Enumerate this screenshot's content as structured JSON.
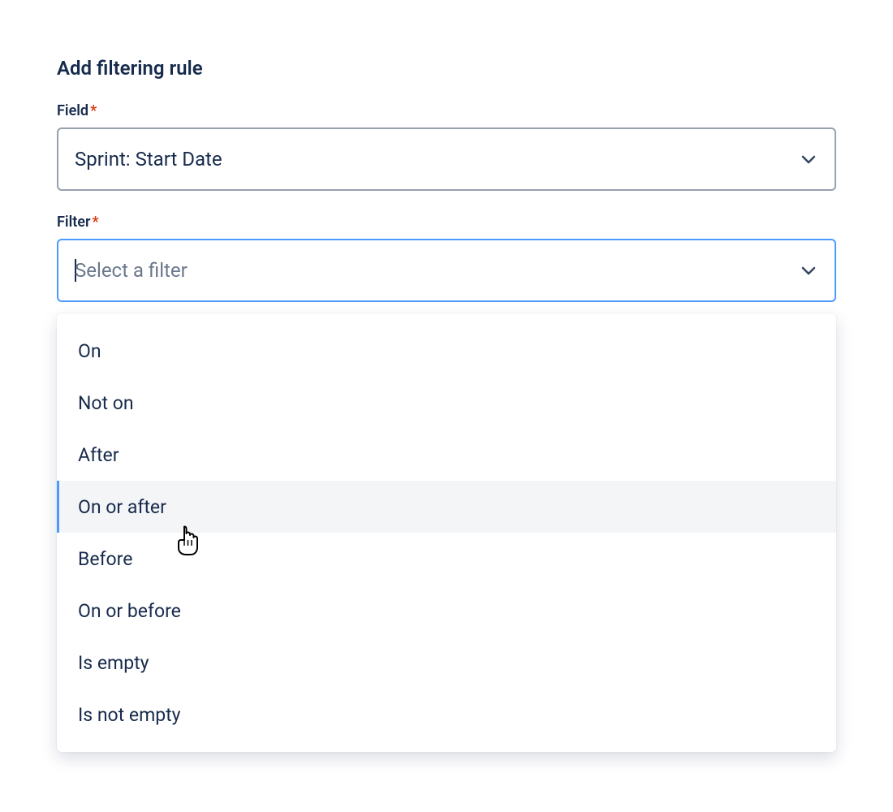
{
  "heading": "Add filtering rule",
  "field": {
    "label": "Field",
    "required": "*",
    "value": "Sprint: Start Date"
  },
  "filter": {
    "label": "Filter",
    "required": "*",
    "placeholder": "Select a filter",
    "options": [
      {
        "label": "On",
        "highlighted": false
      },
      {
        "label": "Not on",
        "highlighted": false
      },
      {
        "label": "After",
        "highlighted": false
      },
      {
        "label": "On or after",
        "highlighted": true
      },
      {
        "label": "Before",
        "highlighted": false
      },
      {
        "label": "On or before",
        "highlighted": false
      },
      {
        "label": "Is empty",
        "highlighted": false
      },
      {
        "label": "Is not empty",
        "highlighted": false
      }
    ]
  }
}
